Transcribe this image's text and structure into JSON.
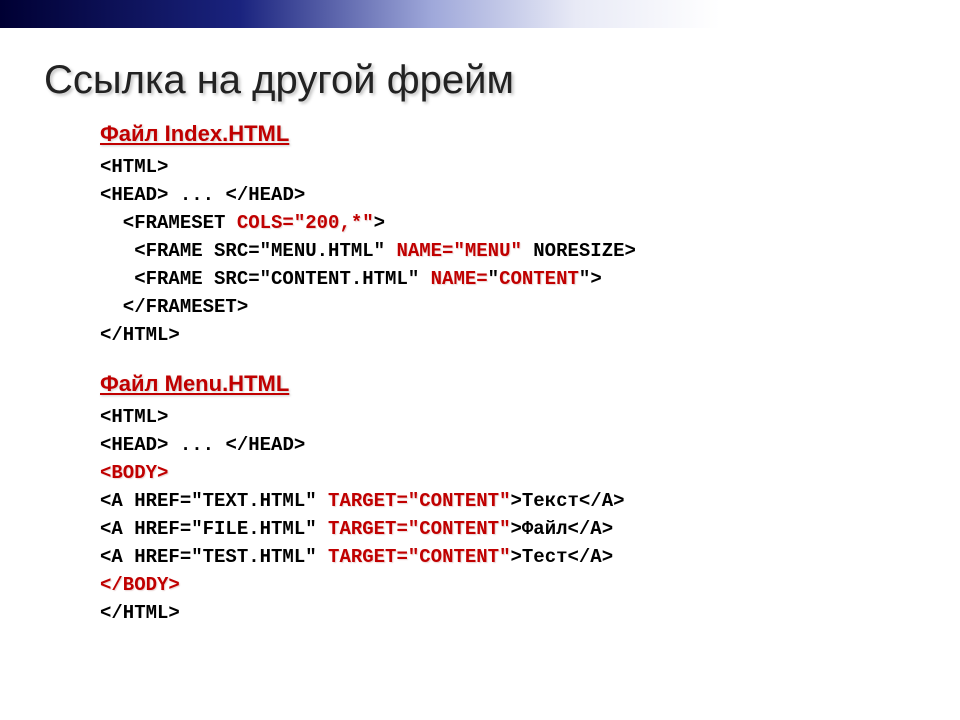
{
  "title": "Ссылка на другой фрейм",
  "file1_label": "Файл Index.HTML",
  "code1_line1": "<HTML>",
  "code1_line2_a": "<HEAD>",
  "code1_line2_b": " ... ",
  "code1_line2_c": "</HEAD>",
  "code1_line3_a": "  <FRAMESET ",
  "code1_line3_b": "COLS=\"200,*\"",
  "code1_line3_c": ">",
  "code1_line4_a": "   <FRAME SRC=\"MENU.HTML\" ",
  "code1_line4_b": "NAME=\"MENU\"",
  "code1_line4_c": " NORESIZE>",
  "code1_line5_a": "   <FRAME SRC=\"CONTENT.HTML\" ",
  "code1_line5_b": "NAME=",
  "code1_line5_c": "\"",
  "code1_line5_d": "CONTENT",
  "code1_line5_e": "\"",
  "code1_line5_f": ">",
  "code1_line6": "  </FRAMESET>",
  "code1_line7": "</HTML>",
  "file2_label": "Файл Menu.HTML",
  "code2_line1": "<HTML>",
  "code2_line2_a": "<HEAD>",
  "code2_line2_b": " ... ",
  "code2_line2_c": "</HEAD>",
  "code2_line3": "<BODY>",
  "code2_line4_a": "<A HREF=\"TEXT.HTML\" ",
  "code2_line4_b": "TARGET=\"CONTENT\"",
  "code2_line4_c": ">Текст</A>",
  "code2_line5_a": "<A HREF=\"FILE.HTML\" ",
  "code2_line5_b": "TARGET=\"CONTENT\"",
  "code2_line5_c": ">Файл</A>",
  "code2_line6_a": "<A HREF=\"TEST.HTML\" ",
  "code2_line6_b": "TARGET=\"CONTENT\"",
  "code2_line6_c": ">Тест</A>",
  "code2_line7": "</BODY>",
  "code2_line8": "</HTML>"
}
